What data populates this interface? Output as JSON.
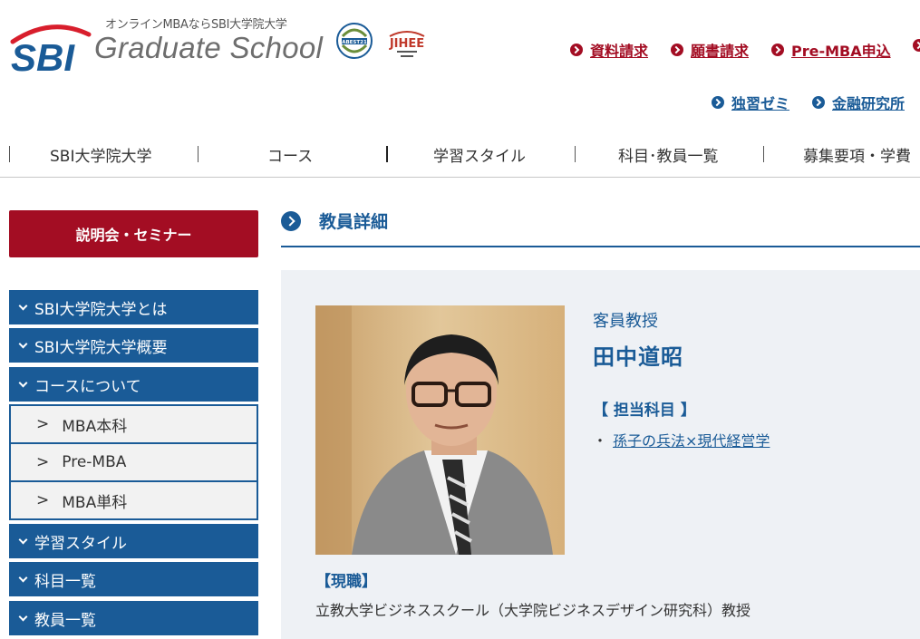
{
  "header": {
    "tagline": "オンラインMBAならSBI大学院大学",
    "logo_text": "SBI",
    "title": "Graduate School",
    "badge_abest_text": "ABEST21",
    "badge_jihee_text": "JIHEE",
    "links_top": [
      "資料請求",
      "願書請求",
      "Pre-MBA申込"
    ],
    "links_bottom": [
      "独習ゼミ",
      "金融研究所"
    ]
  },
  "nav": {
    "items": [
      "SBI大学院大学",
      "コース",
      "学習スタイル",
      "科目･教員一覧",
      "募集要項・学費"
    ]
  },
  "sidebar": {
    "seminar_button": "説明会・セミナー",
    "items_top": [
      "SBI大学院大学とは",
      "SBI大学院大学概要",
      "コースについて"
    ],
    "sub_items": [
      "MBA本科",
      "Pre-MBA",
      "MBA単科"
    ],
    "sub_marker": ">",
    "items_bottom": [
      "学習スタイル",
      "科目一覧",
      "教員一覧"
    ]
  },
  "main": {
    "section_title": "教員詳細",
    "profile": {
      "role": "客員教授",
      "name": "田中道昭",
      "subjects_heading": "【 担当科目 】",
      "subject_bullet": "・",
      "subject": "孫子の兵法×現代経営学",
      "current_heading": "【現職】",
      "current_position": "立教大学ビジネススクール（大学院ビジネスデザイン研究科）教授"
    }
  },
  "colors": {
    "brand_red": "#a30d23",
    "brand_blue": "#1a5b97",
    "panel_bg": "#eef1f5"
  }
}
